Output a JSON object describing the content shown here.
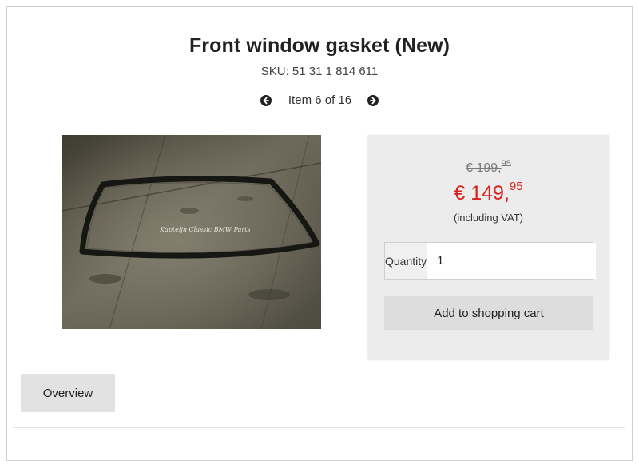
{
  "product": {
    "title": "Front window gasket (New)",
    "sku": "SKU: 51 31 1 814 611"
  },
  "pager": {
    "label": "Item 6 of 16",
    "prev_icon": "arrow-left-circle-icon",
    "next_icon": "arrow-right-circle-icon"
  },
  "image": {
    "watermark": "Kapteijn Classic BMW Parts"
  },
  "pricing": {
    "old_main": "€ 199,",
    "old_cents": "95",
    "new_main": "€ 149,",
    "new_cents": "95",
    "vat_note": "(including VAT)",
    "sale_color": "#d7221f"
  },
  "cart": {
    "quantity_label": "Quantity",
    "quantity_value": "1",
    "add_label": "Add to shopping cart"
  },
  "nav": {
    "overview_label": "Overview"
  }
}
